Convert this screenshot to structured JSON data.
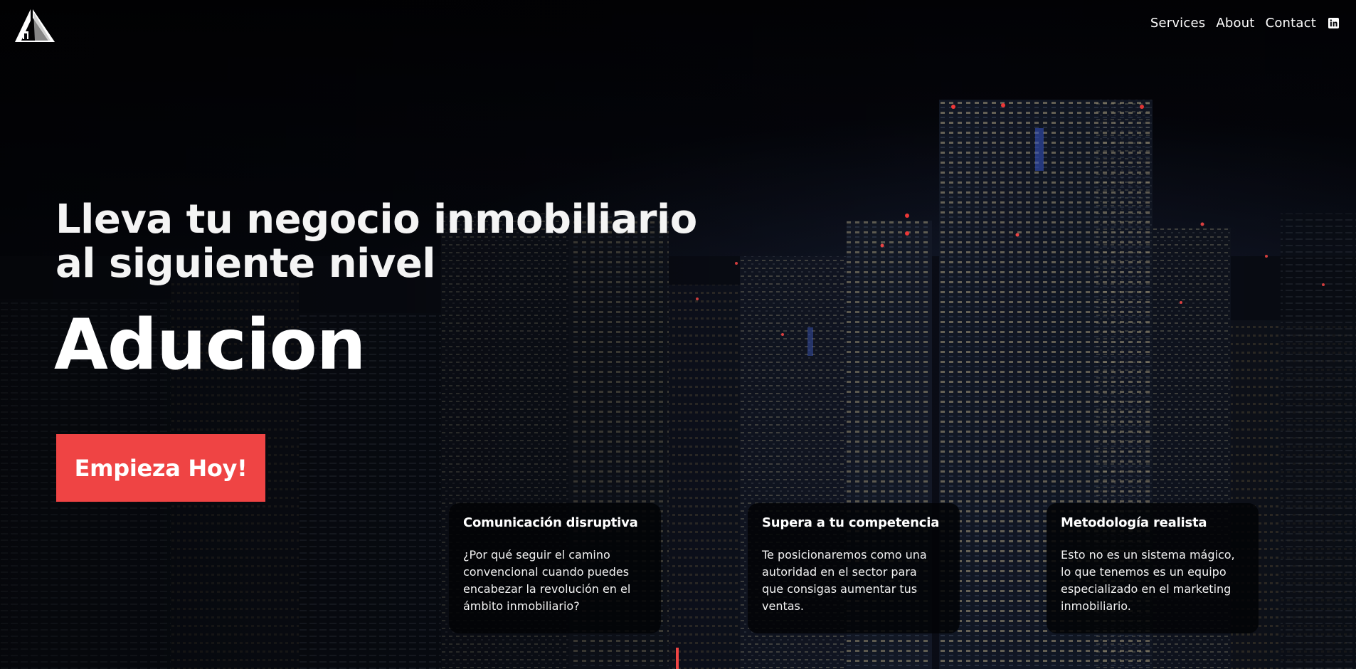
{
  "header": {
    "logo_icon": "house-triangle-logo",
    "nav": [
      {
        "label": "Services"
      },
      {
        "label": "About"
      },
      {
        "label": "Contact"
      }
    ],
    "social_icon": "linkedin-icon"
  },
  "hero": {
    "title_line1": "Lleva tu negocio inmobiliario",
    "title_line2": "al siguiente nivel",
    "brand": "Aducion",
    "cta_label": "Empieza Hoy!"
  },
  "features": [
    {
      "title": "Comunicación disruptiva",
      "lines": [
        "¿Por qué seguir el camino",
        "convencional cuando puedes",
        "encabezar la revolución en el",
        "ámbito inmobiliario?"
      ]
    },
    {
      "title": "Supera a tu competencia",
      "lines": [
        "Te posicionaremos como una",
        "autoridad en el sector para",
        "que consigas aumentar tus",
        "ventas."
      ]
    },
    {
      "title": "Metodología realista",
      "lines": [
        "Esto no es un sistema mágico,",
        "lo que tenemos es un equipo",
        "especializado en el marketing",
        "inmobiliario."
      ]
    }
  ],
  "colors": {
    "accent": "#ef4444",
    "background": "#05060a",
    "text": "#ffffff"
  }
}
